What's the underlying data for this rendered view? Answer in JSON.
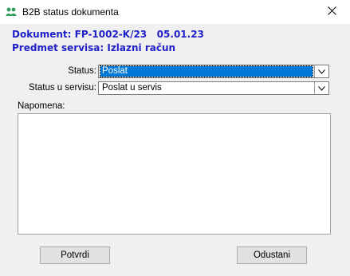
{
  "window": {
    "title": "B2B status dokumenta",
    "icon": "people-exchange-icon",
    "close_icon": "close-icon"
  },
  "info": {
    "document_line": "Dokument: FP-1002-K/23   05.01.23",
    "service_subject_line": "Predmet servisa: Izlazni račun"
  },
  "form": {
    "status_label": "Status:",
    "status_value": "Poslat",
    "service_status_label": "Status u servisu:",
    "service_status_value": "Poslat u servis",
    "note_label": "Napomena:",
    "note_value": ""
  },
  "buttons": {
    "confirm_label": "Potvrdi",
    "cancel_label": "Odustani"
  },
  "colors": {
    "info_text": "#1f1fc8",
    "selection": "#0078d7",
    "icon_green": "#2e9e5b"
  }
}
